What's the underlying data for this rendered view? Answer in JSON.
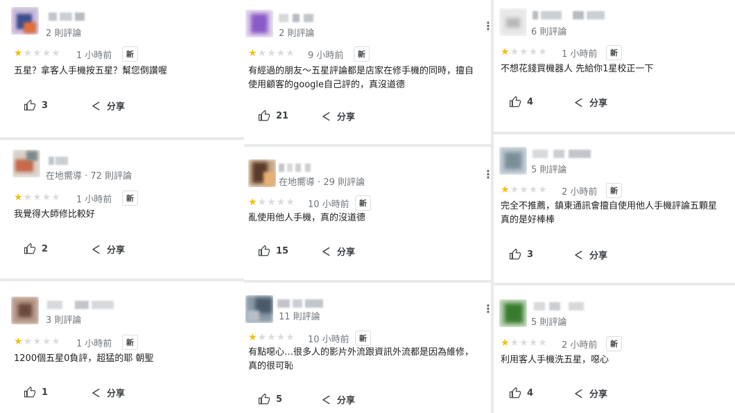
{
  "reviews": [
    {
      "count": "2 則評論",
      "stars": 1,
      "time": "1 小時前",
      "badge": "新",
      "text": [
        "五星？拿客人手機按五星？幫您倒讚喔"
      ],
      "likes": "3",
      "share": "分享"
    },
    {
      "count": "在地嚮導 · 72 則評論",
      "stars": 1,
      "time": "1 小時前",
      "badge": "新",
      "text": [
        "我覺得大師修比較好"
      ],
      "likes": "2",
      "share": "分享"
    },
    {
      "count": "3 則評論",
      "stars": 1,
      "time": "1 小時前",
      "badge": "新",
      "text": [
        "1200個五星0負評，超猛的耶 朝聖"
      ],
      "likes": "1",
      "share": "分享"
    },
    {
      "count": "2 則評論",
      "stars": 1,
      "time": "9 小時前",
      "badge": "新",
      "text": [
        "有經過的朋友～五星評論都是店家在修手機的同時，擅自",
        "使用顧客的google自己評的，真沒道德"
      ],
      "likes": "21",
      "share": "分享"
    },
    {
      "count": "在地嚮導 · 29 則評論",
      "stars": 1,
      "time": "10 小時前",
      "badge": "新",
      "text": [
        "亂使用他人手機，真的沒道德"
      ],
      "likes": "15",
      "share": "分享"
    },
    {
      "count": "11 則評論",
      "stars": 1,
      "time": "10 小時前",
      "badge": "新",
      "text": [
        "有點噁心…很多人的影片外流跟資訊外流都是因為維修，",
        "真的很可恥"
      ],
      "likes": "5",
      "share": "分享"
    },
    {
      "count": "6 則評論",
      "stars": 1,
      "time": "1 小時前",
      "badge": "新",
      "text": [
        "不想花錢買機器人 先給你1星校正一下"
      ],
      "likes": "4",
      "share": "分享"
    },
    {
      "count": "5 則評論",
      "stars": 1,
      "time": "2 小時前",
      "badge": "新",
      "text": [
        "完全不推薦，鎮東通訊會擅自使用他人手機評論五顆星",
        "真的是好棒棒"
      ],
      "likes": "3",
      "share": "分享"
    },
    {
      "count": "5 則評論",
      "stars": 1,
      "time": "2 小時前",
      "badge": "新",
      "text": [
        "利用客人手機洗五星，噁心"
      ],
      "likes": "4",
      "share": "分享"
    }
  ],
  "colors": {
    "star_on": "#fbbc04",
    "star_off": "#dadce0",
    "muted": "#70757a"
  },
  "icons": {
    "like": "thumb-up-icon",
    "share": "share-icon",
    "more": "more-vert-icon"
  }
}
